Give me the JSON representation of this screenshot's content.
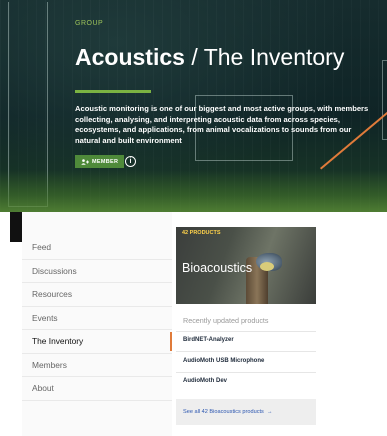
{
  "hero": {
    "group_tag": "GROUP",
    "title_strong": "Acoustics",
    "title_rest": " / The Inventory",
    "description": "Acoustic monitoring is one of our biggest and most active groups, with members collecting, analysing, and interpreting acoustic data from across species, ecosystems, and applications, from animal vocalizations to sounds from our natural and built environment",
    "member_badge": "MEMBER",
    "info_glyph": "i"
  },
  "nav": {
    "items": [
      {
        "label": "Feed"
      },
      {
        "label": "Discussions"
      },
      {
        "label": "Resources"
      },
      {
        "label": "Events"
      },
      {
        "label": "The Inventory",
        "active": true
      },
      {
        "label": "Members"
      },
      {
        "label": "About"
      }
    ]
  },
  "card": {
    "tag": "42 PRODUCTS",
    "title": "Bioacoustics",
    "recent_label": "Recently updated products",
    "products": [
      "BirdNET-Analyzer",
      "AudioMoth USB Microphone",
      "AudioMoth Dev"
    ],
    "see_all": "See all 42 Bioacoustics products",
    "see_all_arrow": "→"
  },
  "colors": {
    "accent_green": "#7bb342",
    "accent_orange": "#e07b3a",
    "link_blue": "#2b56b0"
  }
}
